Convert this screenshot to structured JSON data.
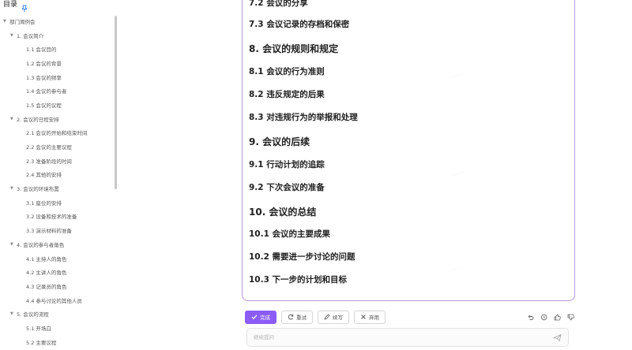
{
  "toc": {
    "title": "目录",
    "items": [
      {
        "label": "部门周例会",
        "level": 0,
        "caret": "▼"
      },
      {
        "label": "1. 会议简介",
        "level": 1,
        "caret": "▼"
      },
      {
        "label": "1.1 会议目的",
        "level": 2
      },
      {
        "label": "1.2 会议的背景",
        "level": 2
      },
      {
        "label": "1.3 会议的频率",
        "level": 2
      },
      {
        "label": "1.4 会议的参与者",
        "level": 2
      },
      {
        "label": "1.5 会议的议程",
        "level": 2
      },
      {
        "label": "2. 会议的日程安排",
        "level": 1,
        "caret": "▼"
      },
      {
        "label": "2.1 会议的开始和结束时间",
        "level": 2
      },
      {
        "label": "2.2 会议的主要议程",
        "level": 2
      },
      {
        "label": "2.3 准备阶段的时间",
        "level": 2
      },
      {
        "label": "2.4 其他的安排",
        "level": 2
      },
      {
        "label": "3. 会议的环境布置",
        "level": 1,
        "caret": "▼"
      },
      {
        "label": "3.1 座位的安排",
        "level": 2
      },
      {
        "label": "3.2 设备和技术的准备",
        "level": 2
      },
      {
        "label": "3.3 演示材料的准备",
        "level": 2
      },
      {
        "label": "4. 会议的参与者角色",
        "level": 1,
        "caret": "▼"
      },
      {
        "label": "4.1 主持人的角色",
        "level": 2
      },
      {
        "label": "4.2 主讲人的角色",
        "level": 2
      },
      {
        "label": "4.3 记录员的角色",
        "level": 2
      },
      {
        "label": "4.4 参与讨论的其他人员",
        "level": 2
      },
      {
        "label": "5. 会议的流程",
        "level": 1,
        "caret": "▼"
      },
      {
        "label": "5.1 开场白",
        "level": 2
      },
      {
        "label": "5.2 主要议程",
        "level": 2
      }
    ]
  },
  "document": {
    "headings": [
      {
        "text": "7.2 会议的分享",
        "level": 3
      },
      {
        "text": "7.3 会议记录的存档和保密",
        "level": 3
      },
      {
        "text": "8. 会议的规则和规定",
        "level": 2
      },
      {
        "text": "8.1 会议的行为准则",
        "level": 3
      },
      {
        "text": "8.2 违反规定的后果",
        "level": 3
      },
      {
        "text": "8.3 对违规行为的举报和处理",
        "level": 3
      },
      {
        "text": "9. 会议的后续",
        "level": 2
      },
      {
        "text": "9.1 行动计划的追踪",
        "level": 3
      },
      {
        "text": "9.2 下次会议的准备",
        "level": 3
      },
      {
        "text": "10. 会议的总结",
        "level": 2
      },
      {
        "text": "10.1 会议的主要成果",
        "level": 3
      },
      {
        "text": "10.2 需要进一步讨论的问题",
        "level": 3
      },
      {
        "text": "10.3 下一步的计划和目标",
        "level": 3
      }
    ]
  },
  "actions": {
    "done_label": "完成",
    "retry_label": "重试",
    "continue_label": "续写",
    "discard_label": "弃用"
  },
  "chat": {
    "placeholder": "继续提问"
  },
  "colors": {
    "accent": "#8b5cf6",
    "border": "#b79bdb",
    "pin": "#3b82f6"
  },
  "icons": [
    "pin-icon",
    "check-icon",
    "refresh-icon",
    "pencil-icon",
    "close-icon",
    "undo-icon",
    "history-icon",
    "thumb-up-icon",
    "thumb-down-icon",
    "send-icon"
  ]
}
